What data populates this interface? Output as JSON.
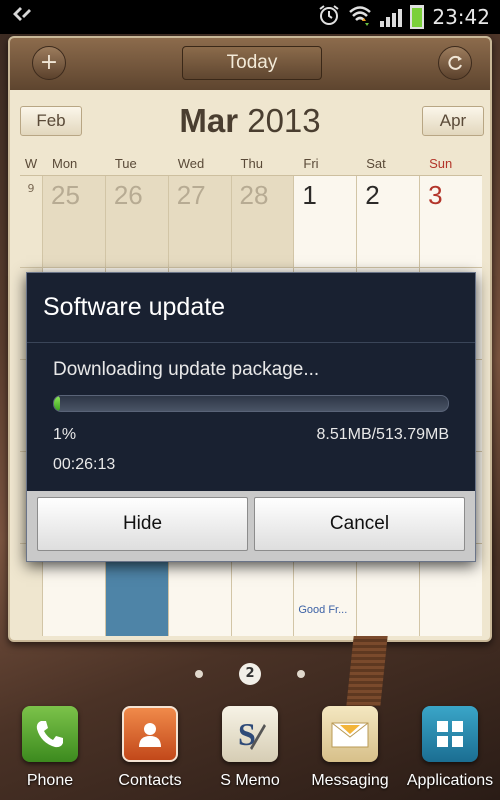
{
  "status_bar": {
    "time": "23:42",
    "icons": [
      "usb-icon",
      "alarm-icon",
      "wifi-icon",
      "signal-icon",
      "battery-icon"
    ],
    "battery_color": "#7bd03a"
  },
  "calendar": {
    "today_label": "Today",
    "prev_month": "Feb",
    "next_month": "Apr",
    "month": "Mar",
    "year": "2013",
    "week_header": "W",
    "day_headers": [
      "Mon",
      "Tue",
      "Wed",
      "Thu",
      "Fri",
      "Sat",
      "Sun"
    ],
    "week_number": "9",
    "week1_days": [
      "25",
      "26",
      "27",
      "28",
      "1",
      "2",
      "3"
    ],
    "last_row_event": "Good Fr..."
  },
  "dialog": {
    "title": "Software update",
    "message": "Downloading update package...",
    "progress_percent": 1,
    "percent_label": "1%",
    "size_label": "8.51MB/513.79MB",
    "elapsed": "00:26:13",
    "hide_label": "Hide",
    "cancel_label": "Cancel",
    "accent_color": "#4ecb2a"
  },
  "home": {
    "page_indicator": "2",
    "dock": [
      {
        "label": "Phone",
        "icon": "phone-icon"
      },
      {
        "label": "Contacts",
        "icon": "contacts-icon"
      },
      {
        "label": "S Memo",
        "icon": "s-memo-icon"
      },
      {
        "label": "Messaging",
        "icon": "messaging-icon"
      },
      {
        "label": "Applications",
        "icon": "applications-icon"
      }
    ]
  }
}
